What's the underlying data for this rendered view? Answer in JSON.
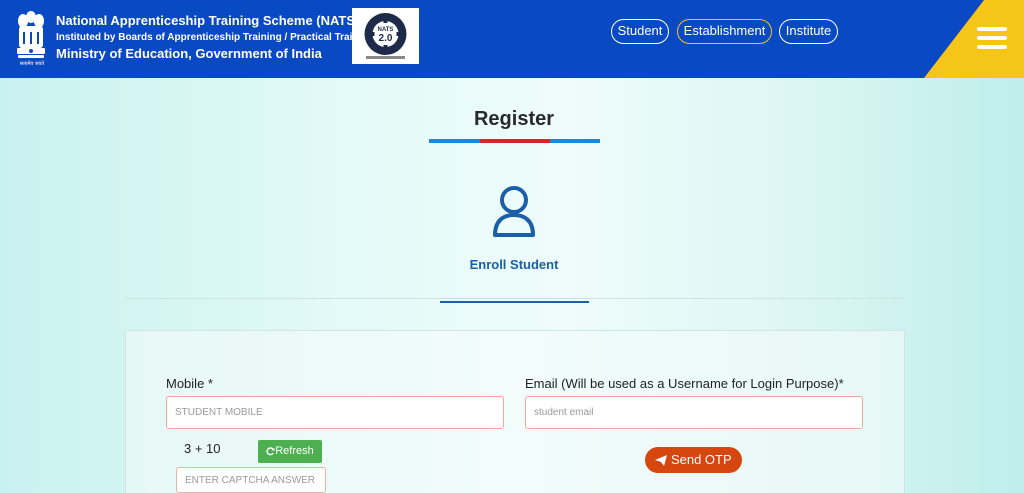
{
  "header": {
    "org_line1": "National Apprenticeship Training Scheme (NATS)",
    "org_line2": "Instituted by Boards of Apprenticeship Training / Practical Training",
    "org_line3": "Ministry of Education, Government of India",
    "emblem_caption": "सत्यमेव जयते",
    "logo_icon": "nats-2-0-logo",
    "nav": {
      "student": "Student",
      "establishment": "Establishment",
      "institute": "Institute"
    },
    "colors": {
      "bar": "#0a49c4",
      "accent": "#f5c518"
    }
  },
  "register": {
    "title": "Register",
    "enroll_label": "Enroll Student",
    "user_icon": "user-icon"
  },
  "form": {
    "mobile_label": "Mobile *",
    "mobile_placeholder": "STUDENT MOBILE",
    "email_label": "Email (Will be used as a Username for Login Purpose)*",
    "email_placeholder": "student email",
    "captcha_question": "3 + 10",
    "refresh_label": "Refresh",
    "captcha_placeholder": "ENTER CAPTCHA ANSWER",
    "send_otp_label": "Send OTP"
  }
}
